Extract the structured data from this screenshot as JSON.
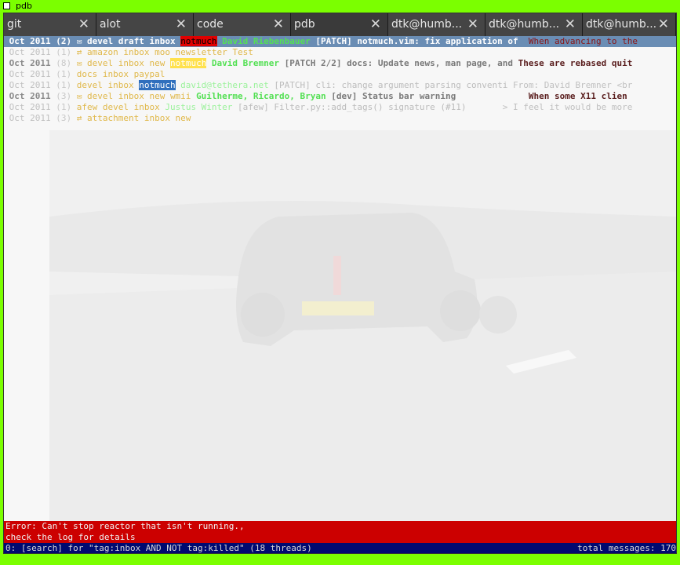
{
  "window": {
    "title": "pdb"
  },
  "tabs": [
    {
      "label": "git"
    },
    {
      "label": "alot"
    },
    {
      "label": "code"
    },
    {
      "label": "pdb"
    },
    {
      "label": "dtk@humb..."
    },
    {
      "label": "dtk@humb..."
    },
    {
      "label": "dtk@humb..."
    }
  ],
  "threads": [
    {
      "date": "Oct 2011",
      "count": "(2)",
      "parts": [
        {
          "t": " ✉ devel draft inbox ",
          "c": "c-tags2"
        },
        {
          "t": "notmuch",
          "c": "c-hlred"
        },
        {
          "t": " David Riebenbauer",
          "c": "c-auth"
        },
        {
          "t": " [PATCH] notmuch.vim: fix application of  ",
          "c": "c-subj"
        },
        {
          "t": "When advancing to the",
          "c": "c-sum"
        }
      ]
    },
    {
      "date": "Oct 2011",
      "count": "(1)",
      "parts": [
        {
          "t": " ⇄ amazon inbox moo newsletter Test",
          "c": "c-tags"
        }
      ]
    },
    {
      "date": "Oct 2011",
      "count": "(8)",
      "parts": [
        {
          "t": " ✉ devel inbox new ",
          "c": "c-tags"
        },
        {
          "t": "notmuch",
          "c": "c-hl"
        },
        {
          "t": " David Bremner",
          "c": "c-auth"
        },
        {
          "t": " [PATCH 2/2] docs: Update news, man page, and ",
          "c": "c-subj b"
        },
        {
          "t": "These are rebased quit",
          "c": "c-sum b"
        }
      ]
    },
    {
      "date": "Oct 2011",
      "count": "(1)",
      "parts": [
        {
          "t": " docs inbox paypal",
          "c": "c-tags"
        }
      ]
    },
    {
      "date": "Oct 2011",
      "count": "(1)",
      "parts": [
        {
          "t": " devel inbox ",
          "c": "c-tags"
        },
        {
          "t": "notmuch",
          "c": "c-hlblue"
        },
        {
          "t": " david@tethera.net",
          "c": "c-auth-l"
        },
        {
          "t": " [PATCH] cli: change argument parsing conventi ",
          "c": "c-subj"
        },
        {
          "t": "From: David Bremner <br",
          "c": "c-sum"
        }
      ]
    },
    {
      "date": "Oct 2011",
      "count": "(3)",
      "parts": [
        {
          "t": " ✉ devel inbox new wmii ",
          "c": "c-tags"
        },
        {
          "t": "Guilherme, Ricardo, Bryan",
          "c": "c-auth"
        },
        {
          "t": " [dev] Status bar warning              ",
          "c": "c-subj b"
        },
        {
          "t": "When some X11 clien",
          "c": "c-sum b"
        }
      ]
    },
    {
      "date": "Oct 2011",
      "count": "(1)",
      "parts": [
        {
          "t": " afew devel inbox ",
          "c": "c-tags"
        },
        {
          "t": "Justus Winter",
          "c": "c-auth-l"
        },
        {
          "t": " [afew] Filter.py::add_tags() signature (#11)       ",
          "c": "c-subj"
        },
        {
          "t": "> I feel it would be more",
          "c": "c-sum"
        }
      ]
    },
    {
      "date": "Oct 2011",
      "count": "(3)",
      "parts": [
        {
          "t": " ⇄ attachment inbox new",
          "c": "c-tags"
        }
      ]
    }
  ],
  "error": {
    "line1": "Error: Can't stop reactor that isn't running.,",
    "line2": "check the log for details"
  },
  "status": {
    "left": "0: [search] for \"tag:inbox AND NOT tag:killed\" (18 threads)",
    "right": "total messages: 170"
  },
  "colors": {
    "window_border": "#7bff00",
    "tabbar": "#2e2e2e",
    "selected_row": "#6a8db4",
    "error_bg": "#cc0000",
    "status_bg": "#000a70"
  }
}
